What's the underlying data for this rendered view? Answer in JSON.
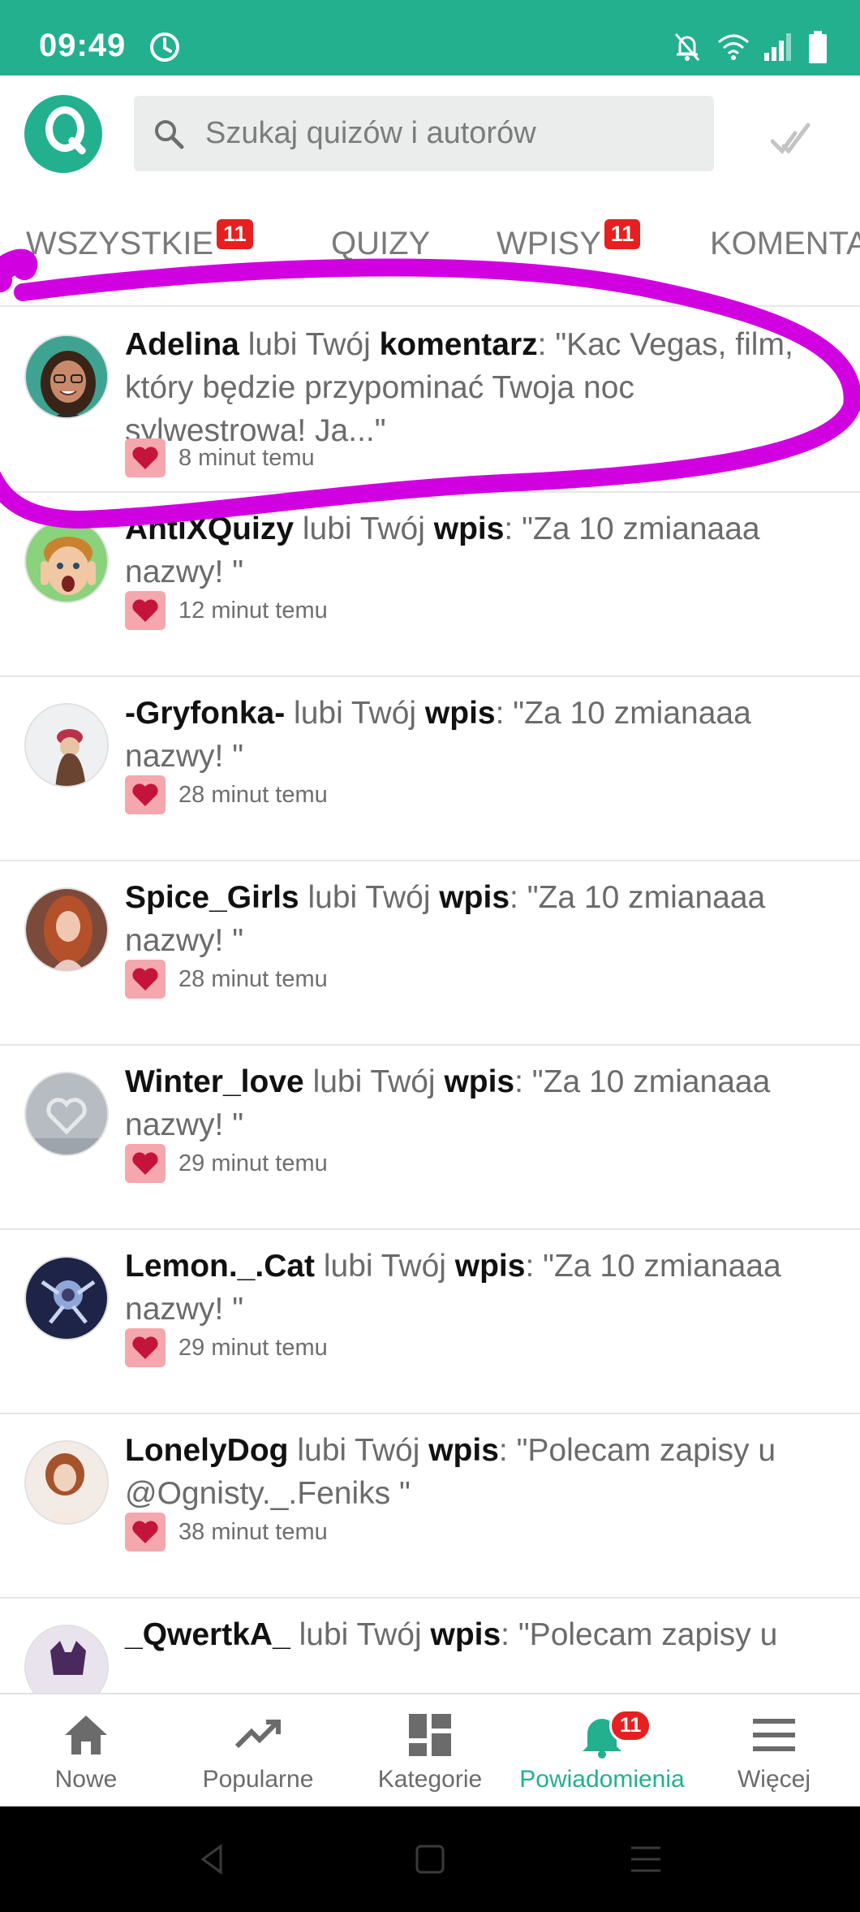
{
  "status_bar": {
    "time": "09:49"
  },
  "header": {
    "search_placeholder": "Szukaj quizów i autorów"
  },
  "tabs": [
    {
      "label": "WSZYSTKIE",
      "badge": "11"
    },
    {
      "label": "QUIZY",
      "badge": ""
    },
    {
      "label": "WPISY",
      "badge": "11"
    },
    {
      "label": "KOMENTARZE",
      "badge": ""
    }
  ],
  "notifications": [
    {
      "user": "Adelina",
      "action": "lubi Twój",
      "object": "komentarz",
      "quote": ": \"Kac Vegas, film, który będzie przypominać Twoja noc sylwestrowa! Ja...\"",
      "time": "8 minut temu",
      "avatar": "cartoon-girl-icon"
    },
    {
      "user": "AntiXQuizy",
      "action": "lubi Twój",
      "object": "wpis",
      "quote": ": \"Za 10 zmianaaa nazwy! \"",
      "time": "12 minut temu",
      "avatar": "boy-face-icon"
    },
    {
      "user": "-Gryfonka-",
      "action": "lubi Twój",
      "object": "wpis",
      "quote": ": \"Za 10 zmianaaa nazwy! \"",
      "time": "28 minut temu",
      "avatar": "winter-girl-icon"
    },
    {
      "user": "Spice_Girls",
      "action": "lubi Twój",
      "object": "wpis",
      "quote": ": \"Za 10 zmianaaa nazwy! \"",
      "time": "28 minut temu",
      "avatar": "redhead-girl-icon"
    },
    {
      "user": "Winter_love",
      "action": "lubi Twój",
      "object": "wpis",
      "quote": ": \"Za 10 zmianaaa nazwy! \"",
      "time": "29 minut temu",
      "avatar": "snow-heart-icon"
    },
    {
      "user": "Lemon._.Cat",
      "action": "lubi Twój",
      "object": "wpis",
      "quote": ": \"Za 10 zmianaaa nazwy! \"",
      "time": "29 minut temu",
      "avatar": "dark-fantasy-icon"
    },
    {
      "user": "LonelyDog",
      "action": "lubi Twój",
      "object": "wpis",
      "quote": ": \"Polecam zapisy u @Ognisty._.Feniks \"",
      "time": "38 minut temu",
      "avatar": "girl-portrait-icon"
    },
    {
      "user": "_QwertkA_",
      "action": "lubi Twój",
      "object": "wpis",
      "quote": ": \"Polecam zapisy u",
      "time": "",
      "avatar": "purple-cat-icon"
    }
  ],
  "bottom_nav": [
    {
      "label": "Nowe",
      "icon": "home-icon",
      "active": false
    },
    {
      "label": "Popularne",
      "icon": "trending-icon",
      "active": false
    },
    {
      "label": "Kategorie",
      "icon": "dashboard-icon",
      "active": false
    },
    {
      "label": "Powiadomienia",
      "icon": "bell-icon",
      "active": true,
      "badge": "11"
    },
    {
      "label": "Więcej",
      "icon": "menu-icon",
      "active": false
    }
  ],
  "colors": {
    "brand": "#22b08f",
    "badge": "#e62020",
    "heart_bg": "#f4a7ad",
    "heart": "#c4143c",
    "annotation": "#d100e0"
  }
}
